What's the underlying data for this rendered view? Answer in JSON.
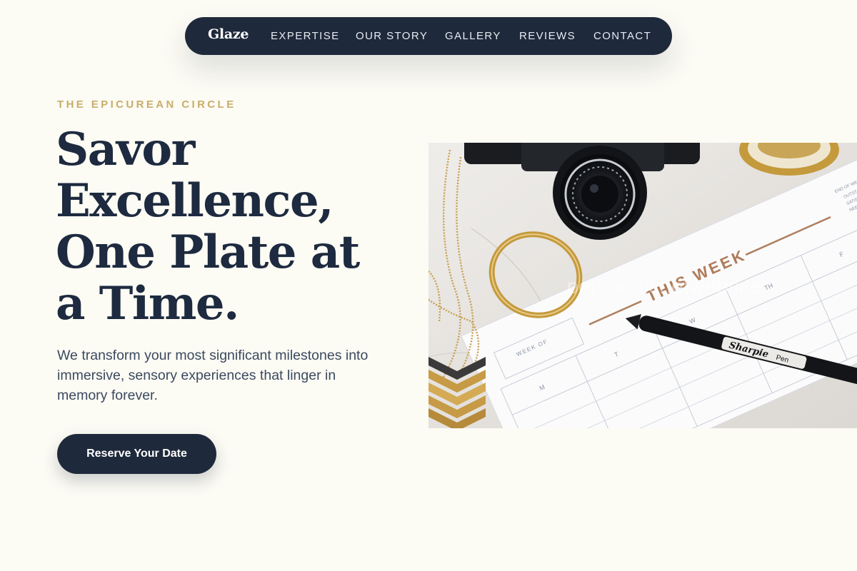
{
  "nav": {
    "brand": "Glaze",
    "links": [
      "EXPERTISE",
      "OUR STORY",
      "GALLERY",
      "REVIEWS",
      "CONTACT"
    ]
  },
  "hero": {
    "eyebrow": "THE EPICUREAN CIRCLE",
    "headline_lines": [
      "Savor",
      "Excellence,",
      "One Plate at",
      "a Time."
    ],
    "subtext": "We transform your most significant milestones into immersive, sensory experiences that linger in memory forever.",
    "cta_label": "Reserve Your Date"
  },
  "image": {
    "planner_title": "THIS WEEK",
    "week_of_label": "WEEK OF",
    "day_labels": [
      "M",
      "T",
      "W",
      "TH",
      "F"
    ],
    "end_of_week_label": "END OF WEEK ASSESS",
    "checklist": [
      "OUTSTANDING",
      "SATISFACTORY",
      "NEEDS IMPR"
    ],
    "pen_brand": "Sharpie",
    "pen_type": "Pen",
    "watermark": "personalchefwebsite"
  },
  "colors": {
    "background": "#fcfbf4",
    "navy": "#1e293b",
    "gold": "#c9ad69",
    "body_text": "#3b4a5f"
  }
}
